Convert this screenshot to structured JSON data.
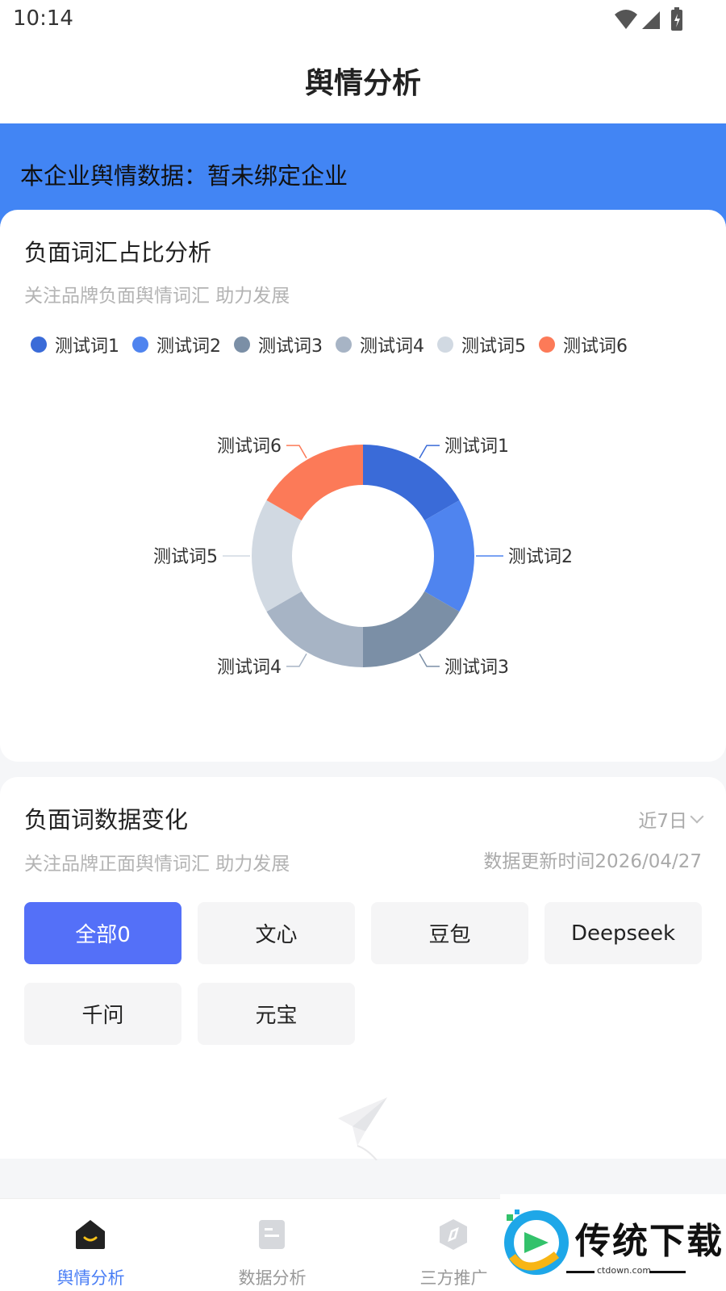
{
  "status_bar": {
    "time": "10:14"
  },
  "header": {
    "title": "舆情分析"
  },
  "banner": {
    "text": "本企业舆情数据：暂未绑定企业"
  },
  "negative_ratio": {
    "title": "负面词汇占比分析",
    "subtitle": "关注品牌负面舆情词汇 助力发展",
    "legend": [
      {
        "label": "测试词1",
        "color": "#3a6bd8"
      },
      {
        "label": "测试词2",
        "color": "#4f84ef"
      },
      {
        "label": "测试词3",
        "color": "#7b8fa6"
      },
      {
        "label": "测试词4",
        "color": "#a7b4c5"
      },
      {
        "label": "测试词5",
        "color": "#d1d9e2"
      },
      {
        "label": "测试词6",
        "color": "#fc7a58"
      }
    ]
  },
  "chart_data": {
    "type": "pie",
    "categories": [
      "测试词1",
      "测试词2",
      "测试词3",
      "测试词4",
      "测试词5",
      "测试词6"
    ],
    "values": [
      1,
      1,
      1,
      1,
      1,
      1
    ],
    "colors": [
      "#3a6bd8",
      "#4f84ef",
      "#7b8fa6",
      "#a7b4c5",
      "#d1d9e2",
      "#fc7a58"
    ],
    "donut": true
  },
  "negative_trend": {
    "title": "负面词数据变化",
    "subtitle": "关注品牌正面舆情词汇 助力发展",
    "range": "近7日",
    "update_time": "数据更新时间2026/04/27",
    "filters": [
      "全部0",
      "文心",
      "豆包",
      "Deepseek",
      "千问",
      "元宝"
    ],
    "active_filter": 0
  },
  "nav": {
    "items": [
      {
        "label": "舆情分析",
        "icon": "home-icon"
      },
      {
        "label": "数据分析",
        "icon": "document-icon"
      },
      {
        "label": "三方推广",
        "icon": "compass-icon"
      }
    ],
    "active": 0
  },
  "watermark": {
    "text": "传统下载",
    "sub": "ctdown.com"
  }
}
